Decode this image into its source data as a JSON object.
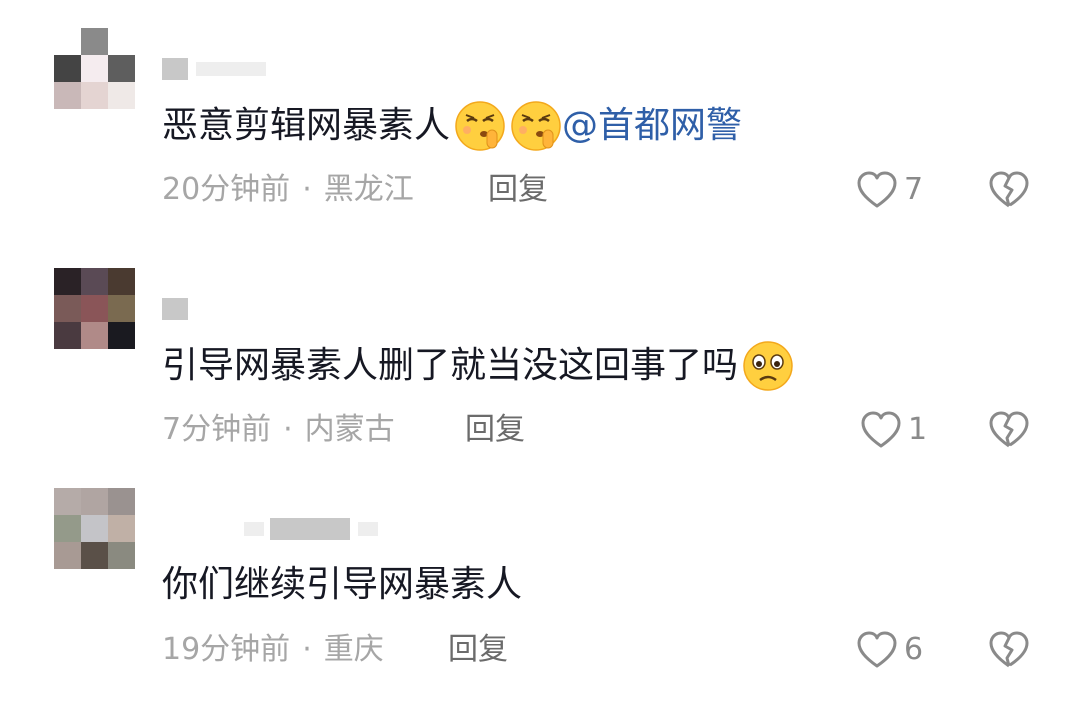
{
  "comments": [
    {
      "text": "恶意剪辑网暴素人",
      "emojis": [
        "shush-emoji",
        "shush-emoji"
      ],
      "mention": "@首都网警",
      "time": "20分钟前",
      "location": "黑龙江",
      "reply_label": "回复",
      "like_count": "7",
      "avatar_colors": [
        "#ffffff",
        "#8a8a8a",
        "#ffffff",
        "#444444",
        "#f5ecef",
        "#5e5e5e",
        "#c9b8b8",
        "#e4d4d2",
        "#efe9e7"
      ]
    },
    {
      "text": "引导网暴素人删了就当没这回事了吗",
      "emojis": [
        "sad-emoji"
      ],
      "mention": "",
      "time": "7分钟前",
      "location": "内蒙古",
      "reply_label": "回复",
      "like_count": "1",
      "avatar_colors": [
        "#2a2226",
        "#5a4a55",
        "#4a3a30",
        "#7a5a58",
        "#8a5558",
        "#7a6a50",
        "#4a3a40",
        "#b08a88",
        "#1a1a20"
      ]
    },
    {
      "text": "你们继续引导网暴素人",
      "emojis": [],
      "mention": "",
      "time": "19分钟前",
      "location": "重庆",
      "reply_label": "回复",
      "like_count": "6",
      "avatar_colors": [
        "#b5aba8",
        "#b0a5a2",
        "#9a9290",
        "#949a8a",
        "#c4c4c8",
        "#c0b0a6",
        "#a89a94",
        "#5a5048",
        "#8a8a80"
      ]
    }
  ],
  "meta_separator": "·",
  "colors": {
    "text": "#161823",
    "mention": "#2f5fa8",
    "meta": "#a6a6a6",
    "reply": "#6b6b6b",
    "icon": "#8a8a8a"
  }
}
